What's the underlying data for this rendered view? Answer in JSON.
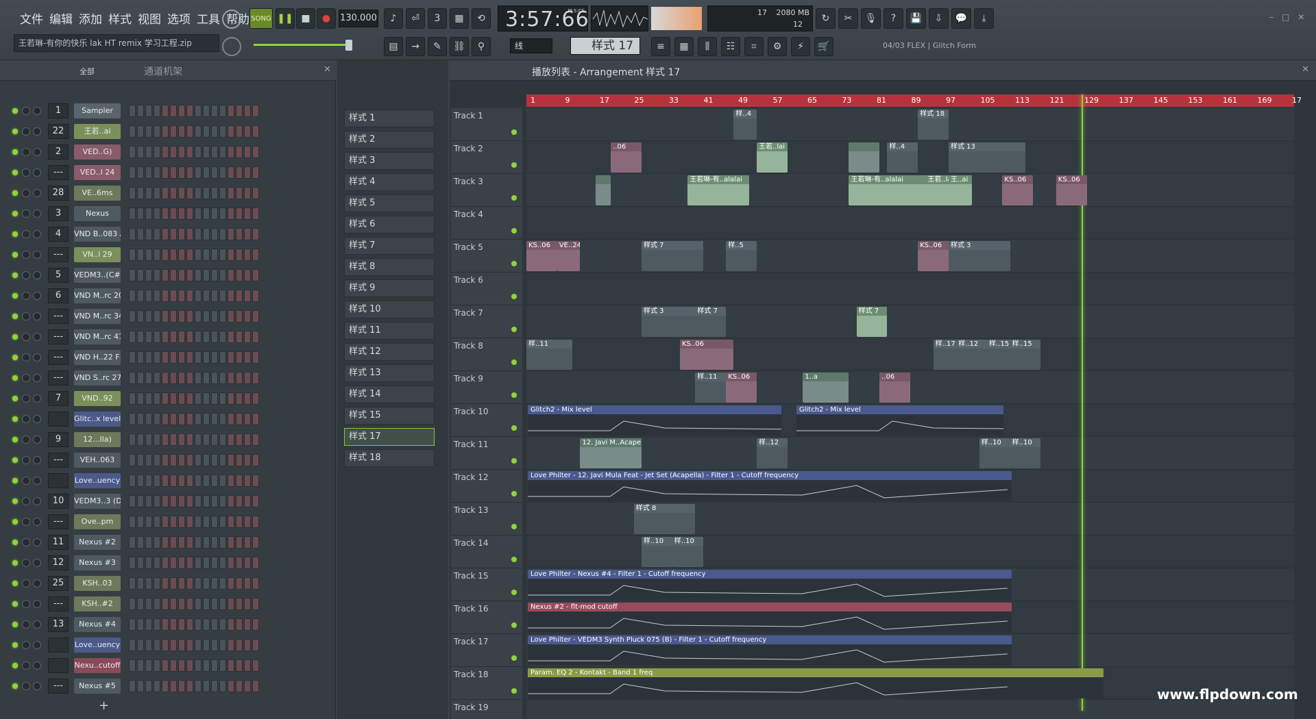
{
  "menu": [
    "文件",
    "编辑",
    "添加",
    "样式",
    "视图",
    "选项",
    "工具",
    "帮助"
  ],
  "song_label": "SONG",
  "tempo": "130.000",
  "time": "3:57:66",
  "time_unit": "M:S:CS",
  "cpu_top": "17",
  "mem": "2080 MB",
  "poly": "12",
  "filename": "王若琳-有你的快乐 lak HT remix 学习工程.zip",
  "pattern_display": "样式 17",
  "snap": "线",
  "hint": "04/03  FLEX | Glitch Form",
  "rack_title": "通道机架",
  "rack_filter": "全部",
  "breadcrumb": {
    "a": "播放列表 - Arrangement",
    "b": "样式 17"
  },
  "channels": [
    {
      "n": "1",
      "name": "Sampler",
      "c": "#5a646b"
    },
    {
      "n": "22",
      "name": "王若..ai",
      "c": "#7b8f5a"
    },
    {
      "n": "2",
      "name": "VED..G)",
      "c": "#8a5b6b"
    },
    {
      "n": "---",
      "name": "VED..l 24",
      "c": "#8a5b6b"
    },
    {
      "n": "28",
      "name": "VE..6ms",
      "c": "#6a7a5a"
    },
    {
      "n": "3",
      "name": "Nexus",
      "c": "#4f5a60"
    },
    {
      "n": "4",
      "name": "VND B..083 A",
      "c": "#4f5a60"
    },
    {
      "n": "---",
      "name": "VN..l 29",
      "c": "#7b8f5a"
    },
    {
      "n": "5",
      "name": "VEDM3..(C#m)",
      "c": "#4f5a60"
    },
    {
      "n": "6",
      "name": "VND M..rc 20",
      "c": "#4f5a60"
    },
    {
      "n": "---",
      "name": "VND M..rc 34",
      "c": "#4f5a60"
    },
    {
      "n": "---",
      "name": "VND M..rc 41",
      "c": "#4f5a60"
    },
    {
      "n": "---",
      "name": "VND H..22 F#",
      "c": "#4f5a60"
    },
    {
      "n": "---",
      "name": "VND S..rc 27",
      "c": "#4f5a60"
    },
    {
      "n": "7",
      "name": "VND..92",
      "c": "#7b8f5a"
    },
    {
      "n": "",
      "name": "Glitc..x level",
      "c": "#4b5a8a"
    },
    {
      "n": "9",
      "name": "12...lla)",
      "c": "#6a7a5a"
    },
    {
      "n": "---",
      "name": "VEH..063",
      "c": "#4f5a60"
    },
    {
      "n": "",
      "name": "Love..uency",
      "c": "#4b5a8a"
    },
    {
      "n": "10",
      "name": "VEDM3..3 (D)",
      "c": "#4f5a60"
    },
    {
      "n": "---",
      "name": "Ove..pm",
      "c": "#6a7a5a"
    },
    {
      "n": "11",
      "name": "Nexus #2",
      "c": "#4f5a60"
    },
    {
      "n": "12",
      "name": "Nexus #3",
      "c": "#4f5a60"
    },
    {
      "n": "25",
      "name": "KSH..03",
      "c": "#6a7a5a"
    },
    {
      "n": "---",
      "name": "KSH..#2",
      "c": "#6a7a5a"
    },
    {
      "n": "13",
      "name": "Nexus #4",
      "c": "#4f5a60"
    },
    {
      "n": "",
      "name": "Love..uency",
      "c": "#4b5a8a"
    },
    {
      "n": "",
      "name": "Nexu..cutoff",
      "c": "#8a4a5a"
    },
    {
      "n": "---",
      "name": "Nexus #5",
      "c": "#4f5a60"
    }
  ],
  "patterns": [
    "样式 1",
    "样式 2",
    "样式 3",
    "样式 4",
    "样式 5",
    "样式 6",
    "样式 7",
    "样式 8",
    "样式 9",
    "样式 10",
    "样式 11",
    "样式 12",
    "样式 13",
    "样式 14",
    "样式 15",
    "样式 17",
    "样式 18"
  ],
  "ruler": [
    "1",
    "9",
    "17",
    "25",
    "33",
    "41",
    "49",
    "57",
    "65",
    "73",
    "81",
    "89",
    "97",
    "105",
    "113",
    "121",
    "129",
    "137",
    "145",
    "153",
    "161",
    "169",
    "17"
  ],
  "tracks": [
    "Track 1",
    "Track 2",
    "Track 3",
    "Track 4",
    "Track 5",
    "Track 6",
    "Track 7",
    "Track 8",
    "Track 9",
    "Track 10",
    "Track 11",
    "Track 12",
    "Track 13",
    "Track 14",
    "Track 15",
    "Track 16",
    "Track 17",
    "Track 18",
    "Track 19"
  ],
  "clips": [
    {
      "t": 0,
      "s": 0.27,
      "w": 0.03,
      "k": "pt",
      "l": "样..4"
    },
    {
      "t": 0,
      "s": 0.51,
      "w": 0.04,
      "k": "pt",
      "l": "样式 18"
    },
    {
      "t": 1,
      "s": 0.11,
      "w": 0.04,
      "k": "pk",
      "l": "..06"
    },
    {
      "t": 1,
      "s": 0.3,
      "w": 0.04,
      "k": "grn",
      "l": "王若..lai"
    },
    {
      "t": 1,
      "s": 0.42,
      "w": 0.04,
      "k": "au",
      "l": ""
    },
    {
      "t": 1,
      "s": 0.47,
      "w": 0.04,
      "k": "pt",
      "l": "样..4"
    },
    {
      "t": 1,
      "s": 0.55,
      "w": 0.1,
      "k": "pt",
      "l": "样式 13"
    },
    {
      "t": 2,
      "s": 0.09,
      "w": 0.02,
      "k": "au",
      "l": ""
    },
    {
      "t": 2,
      "s": 0.21,
      "w": 0.08,
      "k": "grn",
      "l": "王若琳-有..alalai"
    },
    {
      "t": 2,
      "s": 0.42,
      "w": 0.12,
      "k": "grn",
      "l": "王若琳-有..alalai"
    },
    {
      "t": 2,
      "s": 0.52,
      "w": 0.04,
      "k": "grn",
      "l": "王若..lai"
    },
    {
      "t": 2,
      "s": 0.55,
      "w": 0.03,
      "k": "grn",
      "l": "王..ai"
    },
    {
      "t": 2,
      "s": 0.62,
      "w": 0.04,
      "k": "pk",
      "l": "KS..06"
    },
    {
      "t": 2,
      "s": 0.69,
      "w": 0.04,
      "k": "pk",
      "l": "KS..06"
    },
    {
      "t": 4,
      "s": 0.0,
      "w": 0.04,
      "k": "pk",
      "l": "KS..06"
    },
    {
      "t": 4,
      "s": 0.04,
      "w": 0.03,
      "k": "pk",
      "l": "VE..24"
    },
    {
      "t": 4,
      "s": 0.15,
      "w": 0.08,
      "k": "pt",
      "l": "样式 7"
    },
    {
      "t": 4,
      "s": 0.26,
      "w": 0.04,
      "k": "pt",
      "l": "样..5"
    },
    {
      "t": 4,
      "s": 0.51,
      "w": 0.04,
      "k": "pk",
      "l": "KS..06"
    },
    {
      "t": 4,
      "s": 0.55,
      "w": 0.08,
      "k": "pt",
      "l": "样式 3"
    },
    {
      "t": 6,
      "s": 0.15,
      "w": 0.08,
      "k": "pt",
      "l": "样式 3"
    },
    {
      "t": 6,
      "s": 0.22,
      "w": 0.04,
      "k": "pt",
      "l": "样式 7"
    },
    {
      "t": 6,
      "s": 0.43,
      "w": 0.04,
      "k": "grn",
      "l": "样式 7"
    },
    {
      "t": 7,
      "s": 0.0,
      "w": 0.06,
      "k": "pt",
      "l": "样..11"
    },
    {
      "t": 7,
      "s": 0.2,
      "w": 0.07,
      "k": "pk",
      "l": "KS..06"
    },
    {
      "t": 7,
      "s": 0.53,
      "w": 0.04,
      "k": "pt",
      "l": "样..17"
    },
    {
      "t": 7,
      "s": 0.56,
      "w": 0.04,
      "k": "pt",
      "l": "样..12"
    },
    {
      "t": 7,
      "s": 0.6,
      "w": 0.04,
      "k": "pt",
      "l": "样..15"
    },
    {
      "t": 7,
      "s": 0.63,
      "w": 0.04,
      "k": "pt",
      "l": "样..15"
    },
    {
      "t": 8,
      "s": 0.22,
      "w": 0.04,
      "k": "pt",
      "l": "样..11"
    },
    {
      "t": 8,
      "s": 0.26,
      "w": 0.04,
      "k": "pk",
      "l": "KS..06"
    },
    {
      "t": 8,
      "s": 0.36,
      "w": 0.06,
      "k": "au",
      "l": "1..a"
    },
    {
      "t": 8,
      "s": 0.46,
      "w": 0.04,
      "k": "pk",
      "l": "..06"
    },
    {
      "t": 10,
      "s": 0.07,
      "w": 0.08,
      "k": "au",
      "l": "12. Javi M..Acapella"
    },
    {
      "t": 10,
      "s": 0.3,
      "w": 0.04,
      "k": "pt",
      "l": "样..12"
    },
    {
      "t": 10,
      "s": 0.59,
      "w": 0.04,
      "k": "pt",
      "l": "样..10"
    },
    {
      "t": 10,
      "s": 0.63,
      "w": 0.04,
      "k": "pt",
      "l": "样..10"
    },
    {
      "t": 12,
      "s": 0.14,
      "w": 0.08,
      "k": "pt",
      "l": "样式 8"
    },
    {
      "t": 13,
      "s": 0.15,
      "w": 0.04,
      "k": "pt",
      "l": "样..10"
    },
    {
      "t": 13,
      "s": 0.19,
      "w": 0.04,
      "k": "pt",
      "l": "样..10"
    }
  ],
  "autos": [
    {
      "t": 9,
      "s": 0.0,
      "w": 0.33,
      "c": "#4a5a8e",
      "l": "Glitch2 - Mix level"
    },
    {
      "t": 9,
      "s": 0.35,
      "w": 0.27,
      "c": "#4a5a8e",
      "l": "Glitch2 - Mix level"
    },
    {
      "t": 11,
      "s": 0.0,
      "w": 0.63,
      "c": "#4a5a8e",
      "l": "Love Philter - 12. Javi Mula Feat - Jet Set (Acapella) - Filter 1 - Cutoff frequency"
    },
    {
      "t": 14,
      "s": 0.0,
      "w": 0.63,
      "c": "#4a5a8e",
      "l": "Love Philter - Nexus #4 - Filter 1 - Cutoff frequency"
    },
    {
      "t": 15,
      "s": 0.0,
      "w": 0.63,
      "c": "#9a4a5e",
      "l": "Nexus #2 - flt-mod cutoff"
    },
    {
      "t": 16,
      "s": 0.0,
      "w": 0.63,
      "c": "#4a5a8e",
      "l": "Love Philter - VEDM3 Synth Pluck 075 (B) - Filter 1 - Cutoff frequency"
    },
    {
      "t": 17,
      "s": 0.0,
      "w": 0.75,
      "c": "#8a9a48",
      "l": "Param. EQ 2 - Kontakt - Band 1 freq"
    }
  ],
  "watermark": "www.flpdown.com"
}
